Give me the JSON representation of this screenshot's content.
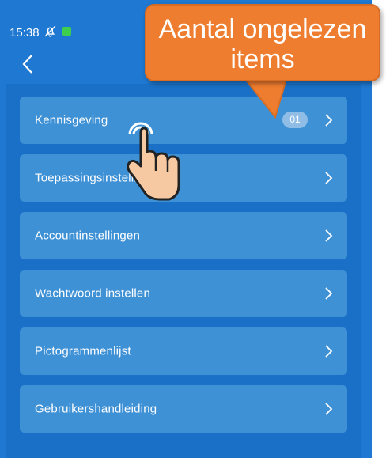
{
  "status": {
    "time": "15:38"
  },
  "menu": {
    "items": [
      {
        "label": "Kennisgeving",
        "badge": "01"
      },
      {
        "label": "Toepassingsinstellingen"
      },
      {
        "label": "Accountinstellingen"
      },
      {
        "label": "Wachtwoord instellen"
      },
      {
        "label": "Pictogrammenlijst"
      },
      {
        "label": "Gebruikershandleiding"
      }
    ]
  },
  "callout": {
    "line1": "Aantal ongelezen",
    "line2": "items"
  },
  "icons": {
    "back": "chevron-left-icon",
    "row": "chevron-right-icon",
    "notifications_off": "bell-off-icon",
    "pointer": "tap-hand-icon"
  },
  "colors": {
    "background": "#1f78d1",
    "panel": "#1a70c6",
    "item": "#3f91d6",
    "badge": "#8fbde6",
    "callout": "#ef7d2f"
  }
}
